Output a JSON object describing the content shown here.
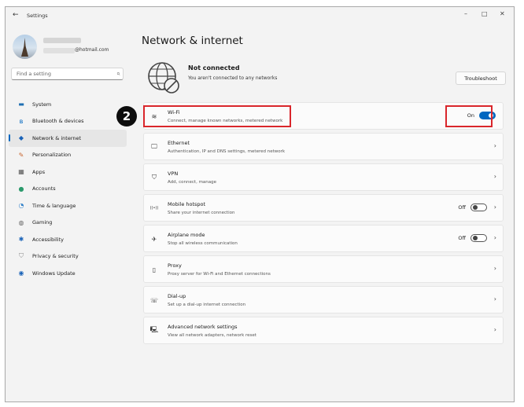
{
  "window": {
    "title": "Settings",
    "back_glyph": "←",
    "minimize_glyph": "–",
    "maximize_glyph": "□",
    "close_glyph": "✕"
  },
  "account": {
    "email_suffix": "@hotmail.com"
  },
  "search": {
    "placeholder": "Find a setting"
  },
  "sidebar": {
    "items": [
      {
        "label": "System",
        "icon": "monitor-icon",
        "glyph": "▬",
        "color": "#1f6fb2"
      },
      {
        "label": "Bluetooth & devices",
        "icon": "bluetooth-icon",
        "glyph": "ʙ",
        "color": "#0067c0"
      },
      {
        "label": "Network & internet",
        "icon": "wifi-diamond-icon",
        "glyph": "◆",
        "color": "#1a63b8",
        "selected": true
      },
      {
        "label": "Personalization",
        "icon": "brush-icon",
        "glyph": "✎",
        "color": "#c8662f"
      },
      {
        "label": "Apps",
        "icon": "apps-icon",
        "glyph": "▦",
        "color": "#555555"
      },
      {
        "label": "Accounts",
        "icon": "person-icon",
        "glyph": "●",
        "color": "#2b9a6c"
      },
      {
        "label": "Time & language",
        "icon": "globe-clock-icon",
        "glyph": "◔",
        "color": "#2f80c9"
      },
      {
        "label": "Gaming",
        "icon": "gamepad-icon",
        "glyph": "◍",
        "color": "#666666"
      },
      {
        "label": "Accessibility",
        "icon": "accessibility-icon",
        "glyph": "✱",
        "color": "#1a63b8"
      },
      {
        "label": "Privacy & security",
        "icon": "shield-icon",
        "glyph": "⛉",
        "color": "#8a8a8a"
      },
      {
        "label": "Windows Update",
        "icon": "update-icon",
        "glyph": "◉",
        "color": "#1a63b8"
      }
    ]
  },
  "main": {
    "title": "Network & internet",
    "status_title": "Not connected",
    "status_desc": "You aren't connected to any networks",
    "troubleshoot_label": "Troubleshoot"
  },
  "rows": [
    {
      "title": "Wi-Fi",
      "desc": "Connect, manage known networks, metered network",
      "icon": "wifi-icon",
      "glyph": "≋",
      "toggle": "On",
      "toggle_on": true,
      "chevron": ""
    },
    {
      "title": "Ethernet",
      "desc": "Authentication, IP and DNS settings, metered network",
      "icon": "ethernet-icon",
      "glyph": "🖵",
      "chevron": "›"
    },
    {
      "title": "VPN",
      "desc": "Add, connect, manage",
      "icon": "vpn-shield-icon",
      "glyph": "⛉",
      "chevron": "›"
    },
    {
      "title": "Mobile hotspot",
      "desc": "Share your internet connection",
      "icon": "hotspot-icon",
      "glyph": "((•))",
      "toggle": "Off",
      "toggle_on": false,
      "chevron": "›"
    },
    {
      "title": "Airplane mode",
      "desc": "Stop all wireless communication",
      "icon": "airplane-icon",
      "glyph": "✈",
      "toggle": "Off",
      "toggle_on": false,
      "chevron": "›"
    },
    {
      "title": "Proxy",
      "desc": "Proxy server for Wi-Fi and Ethernet connections",
      "icon": "proxy-icon",
      "glyph": "▯",
      "chevron": "›"
    },
    {
      "title": "Dial-up",
      "desc": "Set up a dial-up internet connection",
      "icon": "dialup-icon",
      "glyph": "☏",
      "chevron": "›"
    },
    {
      "title": "Advanced network settings",
      "desc": "View all network adapters, network reset",
      "icon": "advanced-network-icon",
      "glyph": "🖳",
      "chevron": "›"
    }
  ],
  "callout": {
    "step_number": "2",
    "highlight_color": "#d9262b"
  }
}
